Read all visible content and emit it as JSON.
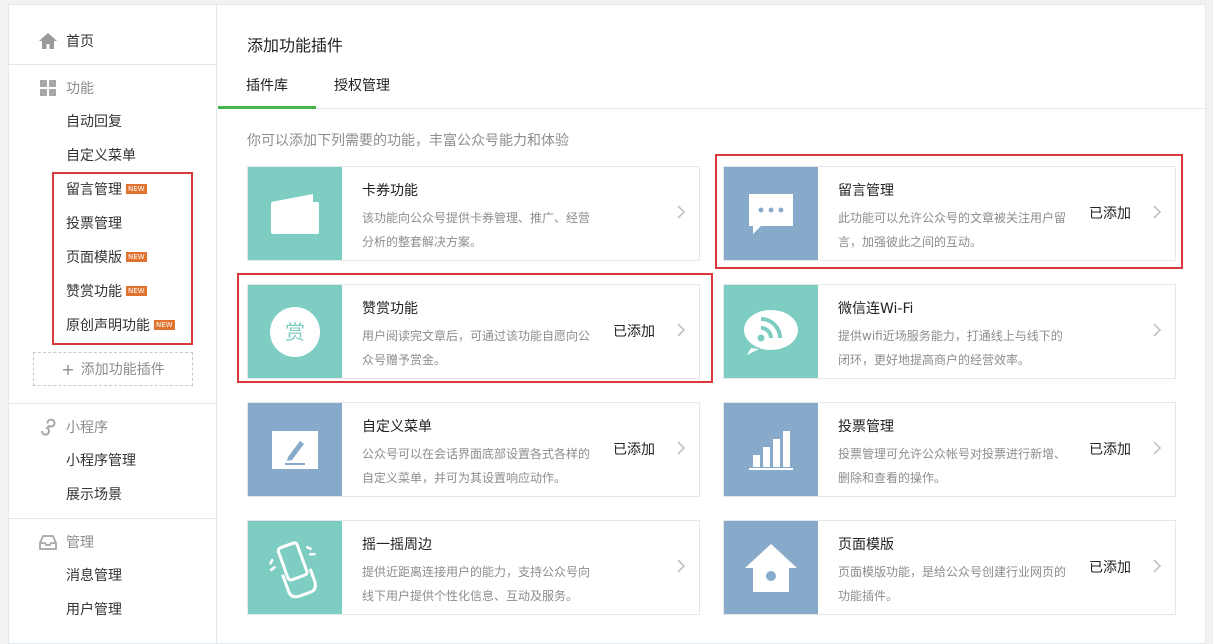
{
  "sidebar": {
    "home": "首页",
    "functions": {
      "title": "功能",
      "items": [
        {
          "label": "自动回复",
          "new": false
        },
        {
          "label": "自定义菜单",
          "new": false
        },
        {
          "label": "留言管理",
          "new": true
        },
        {
          "label": "投票管理",
          "new": false
        },
        {
          "label": "页面模版",
          "new": true
        },
        {
          "label": "赞赏功能",
          "new": true
        },
        {
          "label": "原创声明功能",
          "new": true
        }
      ],
      "add_button": "添加功能插件"
    },
    "miniprogram": {
      "title": "小程序",
      "items": [
        "小程序管理",
        "展示场景"
      ]
    },
    "manage": {
      "title": "管理",
      "items": [
        "消息管理",
        "用户管理"
      ]
    },
    "new_badge": "NEW"
  },
  "main": {
    "title": "添加功能插件",
    "tabs": [
      "插件库",
      "授权管理"
    ],
    "active_tab": "插件库",
    "intro": "你可以添加下列需要的功能，丰富公众号能力和体验",
    "plugins": [
      {
        "name": "卡券功能",
        "desc": "该功能向公众号提供卡券管理、推广、经营分析的整套解决方案。",
        "status": "",
        "color": "teal",
        "icon": "card-icon"
      },
      {
        "name": "留言管理",
        "desc": "此功能可以允许公众号的文章被关注用户留言，加强彼此之间的互动。",
        "status": "已添加",
        "color": "blue",
        "icon": "comment-icon"
      },
      {
        "name": "赞赏功能",
        "desc": "用户阅读完文章后，可通过该功能自愿向公众号赠予赏金。",
        "status": "已添加",
        "color": "teal",
        "icon": "reward-icon"
      },
      {
        "name": "微信连Wi-Fi",
        "desc": "提供wifi近场服务能力，打通线上与线下的闭环，更好地提高商户的经营效率。",
        "status": "",
        "color": "teal",
        "icon": "wifi-icon"
      },
      {
        "name": "自定义菜单",
        "desc": "公众号可以在会话界面底部设置各式各样的自定义菜单，并可为其设置响应动作。",
        "status": "已添加",
        "color": "blue",
        "icon": "edit-icon"
      },
      {
        "name": "投票管理",
        "desc": "投票管理可允许公众帐号对投票进行新增、删除和查看的操作。",
        "status": "已添加",
        "color": "blue",
        "icon": "bar-chart-icon"
      },
      {
        "name": "摇一摇周边",
        "desc": "提供近距离连接用户的能力，支持公众号向线下用户提供个性化信息、互动及服务。",
        "status": "",
        "color": "teal",
        "icon": "shake-icon"
      },
      {
        "name": "页面模版",
        "desc": "页面模版功能，是给公众号创建行业网页的功能插件。",
        "status": "已添加",
        "color": "blue",
        "icon": "house-icon"
      }
    ]
  },
  "colors": {
    "teal": "#7ecdc3",
    "blue": "#87aacb",
    "accent_green": "#44b549",
    "highlight_red": "#d9383d",
    "new_badge": "#e0722f"
  }
}
